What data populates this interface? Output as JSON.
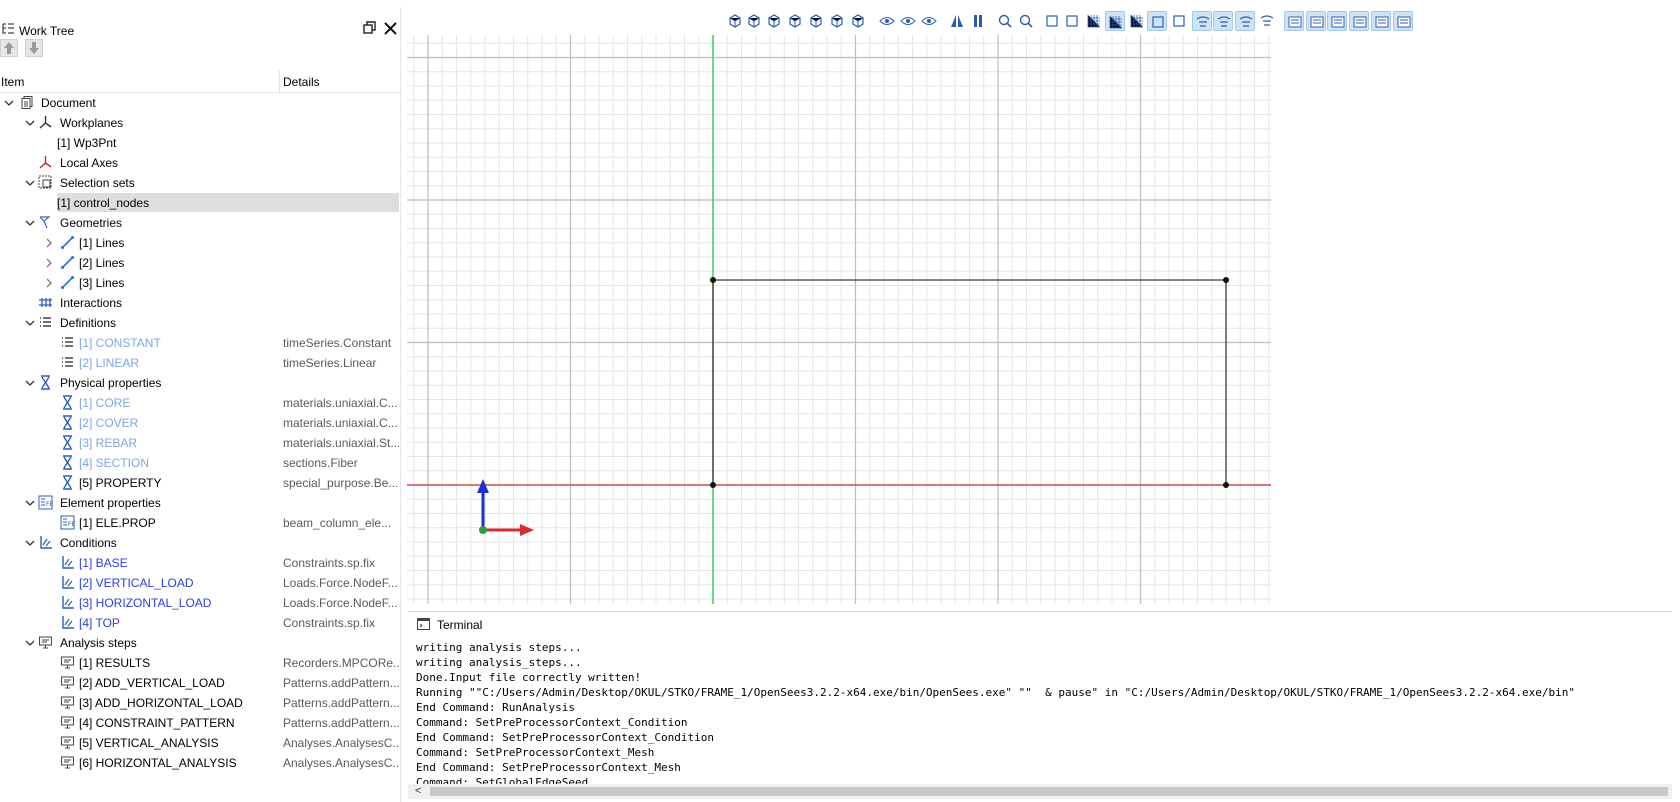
{
  "work_tree": {
    "title": "Work Tree",
    "columns": {
      "item": "Item",
      "details": "Details"
    },
    "rows": [
      {
        "label": "Document",
        "details": "",
        "level": 0,
        "expand": "open",
        "icon": "document-icon",
        "style": ""
      },
      {
        "label": "Workplanes",
        "details": "",
        "level": 1,
        "expand": "open",
        "icon": "workplane-icon",
        "style": ""
      },
      {
        "label": "[1] Wp3Pnt",
        "details": "",
        "level": 2,
        "expand": "",
        "icon": "",
        "style": ""
      },
      {
        "label": "Local Axes",
        "details": "",
        "level": 1,
        "expand": "",
        "icon": "local-axes-icon",
        "style": ""
      },
      {
        "label": "Selection sets",
        "details": "",
        "level": 1,
        "expand": "open",
        "icon": "selection-set-icon",
        "style": ""
      },
      {
        "label": "[1] control_nodes",
        "details": "",
        "level": 2,
        "expand": "",
        "icon": "",
        "style": "selected"
      },
      {
        "label": "Geometries",
        "details": "",
        "level": 1,
        "expand": "open",
        "icon": "geometry-icon",
        "style": ""
      },
      {
        "label": "[1] Lines",
        "details": "",
        "level": 2,
        "expand": "closed",
        "icon": "line-icon",
        "style": ""
      },
      {
        "label": "[2] Lines",
        "details": "",
        "level": 2,
        "expand": "closed",
        "icon": "line-icon",
        "style": ""
      },
      {
        "label": "[3] Lines",
        "details": "",
        "level": 2,
        "expand": "closed",
        "icon": "line-icon",
        "style": ""
      },
      {
        "label": "Interactions",
        "details": "",
        "level": 1,
        "expand": "",
        "icon": "interaction-icon",
        "style": ""
      },
      {
        "label": "Definitions",
        "details": "",
        "level": 1,
        "expand": "open",
        "icon": "list-icon",
        "style": ""
      },
      {
        "label": "[1] CONSTANT",
        "details": "timeSeries.Constant",
        "level": 2,
        "expand": "",
        "icon": "list-icon",
        "style": "dim"
      },
      {
        "label": "[2] LINEAR",
        "details": "timeSeries.Linear",
        "level": 2,
        "expand": "",
        "icon": "list-icon",
        "style": "dim"
      },
      {
        "label": "Physical properties",
        "details": "",
        "level": 1,
        "expand": "open",
        "icon": "physical-property-icon",
        "style": ""
      },
      {
        "label": "[1] CORE",
        "details": "materials.uniaxial.C...",
        "level": 2,
        "expand": "",
        "icon": "physical-property-icon",
        "style": "dim"
      },
      {
        "label": "[2] COVER",
        "details": "materials.uniaxial.C...",
        "level": 2,
        "expand": "",
        "icon": "physical-property-icon",
        "style": "dim"
      },
      {
        "label": "[3] REBAR",
        "details": "materials.uniaxial.St...",
        "level": 2,
        "expand": "",
        "icon": "physical-property-icon",
        "style": "dim"
      },
      {
        "label": "[4] SECTION",
        "details": "sections.Fiber",
        "level": 2,
        "expand": "",
        "icon": "physical-property-icon",
        "style": "dim"
      },
      {
        "label": "[5] PROPERTY",
        "details": "special_purpose.Be...",
        "level": 2,
        "expand": "",
        "icon": "physical-property-icon",
        "style": ""
      },
      {
        "label": "Element properties",
        "details": "",
        "level": 1,
        "expand": "open",
        "icon": "element-property-icon",
        "style": ""
      },
      {
        "label": "[1] ELE.PROP",
        "details": "beam_column_ele...",
        "level": 2,
        "expand": "",
        "icon": "element-property-icon",
        "style": ""
      },
      {
        "label": "Conditions",
        "details": "",
        "level": 1,
        "expand": "open",
        "icon": "condition-icon",
        "style": ""
      },
      {
        "label": "[1] BASE",
        "details": "Constraints.sp.fix",
        "level": 2,
        "expand": "",
        "icon": "condition-icon",
        "style": "blue"
      },
      {
        "label": "[2] VERTICAL_LOAD",
        "details": "Loads.Force.NodeF...",
        "level": 2,
        "expand": "",
        "icon": "condition-icon",
        "style": "blue"
      },
      {
        "label": "[3] HORIZONTAL_LOAD",
        "details": "Loads.Force.NodeF...",
        "level": 2,
        "expand": "",
        "icon": "condition-icon",
        "style": "blue"
      },
      {
        "label": "[4] TOP",
        "details": "Constraints.sp.fix",
        "level": 2,
        "expand": "",
        "icon": "condition-icon",
        "style": "blue"
      },
      {
        "label": "Analysis steps",
        "details": "",
        "level": 1,
        "expand": "open",
        "icon": "monitor-icon",
        "style": ""
      },
      {
        "label": "[1] RESULTS",
        "details": "Recorders.MPCORe...",
        "level": 2,
        "expand": "",
        "icon": "monitor-icon",
        "style": ""
      },
      {
        "label": "[2] ADD_VERTICAL_LOAD",
        "details": "Patterns.addPattern...",
        "level": 2,
        "expand": "",
        "icon": "monitor-icon",
        "style": ""
      },
      {
        "label": "[3] ADD_HORIZONTAL_LOAD",
        "details": "Patterns.addPattern...",
        "level": 2,
        "expand": "",
        "icon": "monitor-icon",
        "style": ""
      },
      {
        "label": "[4] CONSTRAINT_PATTERN",
        "details": "Patterns.addPattern...",
        "level": 2,
        "expand": "",
        "icon": "monitor-icon",
        "style": ""
      },
      {
        "label": "[5] VERTICAL_ANALYSIS",
        "details": "Analyses.AnalysesC...",
        "level": 2,
        "expand": "",
        "icon": "monitor-icon",
        "style": ""
      },
      {
        "label": "[6] HORIZONTAL_ANALYSIS",
        "details": "Analyses.AnalysesC...",
        "level": 2,
        "expand": "",
        "icon": "monitor-icon",
        "style": ""
      }
    ]
  },
  "toolbar": {
    "buttons": [
      {
        "name": "view-iso-icon",
        "active": false
      },
      {
        "name": "view-front-icon",
        "active": false
      },
      {
        "name": "view-back-icon",
        "active": false
      },
      {
        "name": "view-left-icon",
        "active": false
      },
      {
        "name": "view-right-icon",
        "active": false
      },
      {
        "name": "view-top-icon",
        "active": false
      },
      {
        "name": "view-bottom-icon",
        "active": false
      },
      {
        "name": "show-hide-icon",
        "active": false
      },
      {
        "name": "eye-icon",
        "active": false
      },
      {
        "name": "eye-hidden-icon",
        "active": false
      },
      {
        "name": "perspective-icon",
        "active": false
      },
      {
        "name": "orthographic-icon",
        "active": false
      },
      {
        "name": "zoom-fit-icon",
        "active": false
      },
      {
        "name": "zoom-icon",
        "active": false
      },
      {
        "name": "screenshot-icon",
        "active": false
      },
      {
        "name": "paint-icon",
        "active": false
      },
      {
        "name": "grid-icon",
        "active": false
      },
      {
        "name": "grid-snap-icon",
        "active": true
      },
      {
        "name": "axes-icon",
        "active": false
      },
      {
        "name": "select-mode-icon",
        "active": true
      },
      {
        "name": "select-add-icon",
        "active": false
      },
      {
        "name": "filter-vertex-icon",
        "active": true
      },
      {
        "name": "filter-edge-icon",
        "active": true
      },
      {
        "name": "filter-face-icon",
        "active": true
      },
      {
        "name": "filter-solid-icon",
        "active": false
      },
      {
        "name": "layer-1-icon",
        "active": true
      },
      {
        "name": "layer-2-icon",
        "active": true
      },
      {
        "name": "layer-3-icon",
        "active": true
      },
      {
        "name": "layer-4-icon",
        "active": true
      },
      {
        "name": "layer-5-icon",
        "active": true
      },
      {
        "name": "layer-6-icon",
        "active": true
      }
    ]
  },
  "terminal": {
    "title": "Terminal",
    "lines": [
      "writing analysis steps...",
      "writing analysis_steps...",
      "Done.Input file correctly written!",
      "Running \"\"C:/Users/Admin/Desktop/OKUL/STKO/FRAME_1/OpenSees3.2.2-x64.exe/bin/OpenSees.exe\" \"\"  & pause\" in \"C:/Users/Admin/Desktop/OKUL/STKO/FRAME_1/OpenSees3.2.2-x64.exe/bin\"",
      "End Command: RunAnalysis",
      "Command: SetPreProcessorContext_Condition",
      "End Command: SetPreProcessorContext_Condition",
      "Command: SetPreProcessorContext_Mesh",
      "End Command: SetPreProcessorContext_Mesh",
      "Command: SetGlobalEdgeSeed"
    ],
    "scroll_left_glyph": "<"
  },
  "colors": {
    "x_axis": "#c0392b",
    "y_axis": "#2ecc40",
    "frame": "#3a3a3a",
    "triad_x": "#d32f2f",
    "triad_y": "#1a2fd6",
    "triad_origin": "#2e9e44",
    "selection_highlight": "#dedede",
    "dim_item": "#7ea4e6",
    "condition_item": "#2b3ee0",
    "active_toolbar": "#cfe3f7"
  }
}
